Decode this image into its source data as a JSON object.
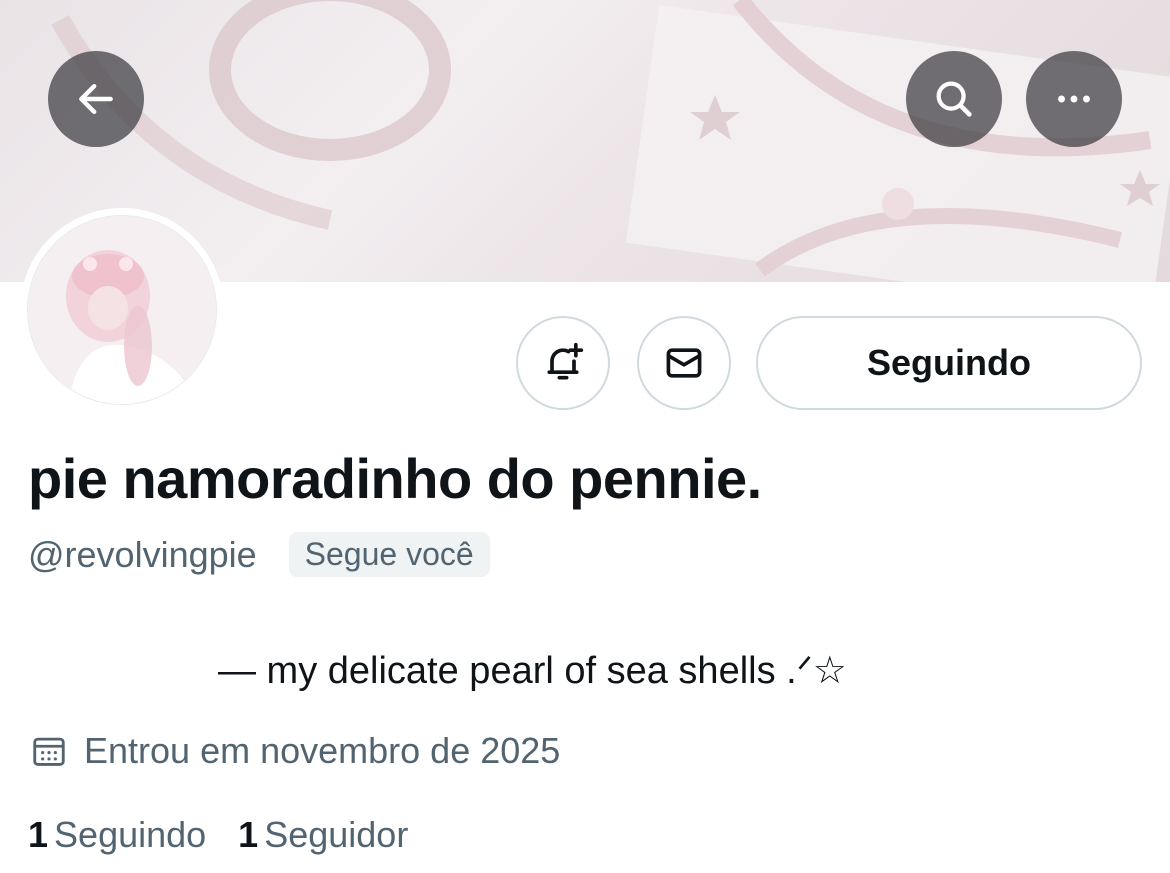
{
  "header": {
    "back_icon": "arrow-left-icon",
    "search_icon": "search-icon",
    "more_icon": "more-horizontal-icon"
  },
  "profile": {
    "display_name": "pie namoradinho do pennie.",
    "handle": "@revolvingpie",
    "follows_you": "Segue você",
    "bio": "— my delicate pearl of sea shells .ᐟ☆",
    "joined": "Entrou em novembro de 2025",
    "joined_icon": "calendar-icon"
  },
  "actions": {
    "notify_icon": "bell-plus-icon",
    "message_icon": "mail-icon",
    "following_label": "Seguindo"
  },
  "stats": {
    "following_count": "1",
    "following_label": "Seguindo",
    "followers_count": "1",
    "followers_label": "Seguidor"
  },
  "colors": {
    "text_primary": "#0f1419",
    "text_secondary": "#536471",
    "border": "#cfd9de",
    "badge_bg": "#eff3f4"
  }
}
